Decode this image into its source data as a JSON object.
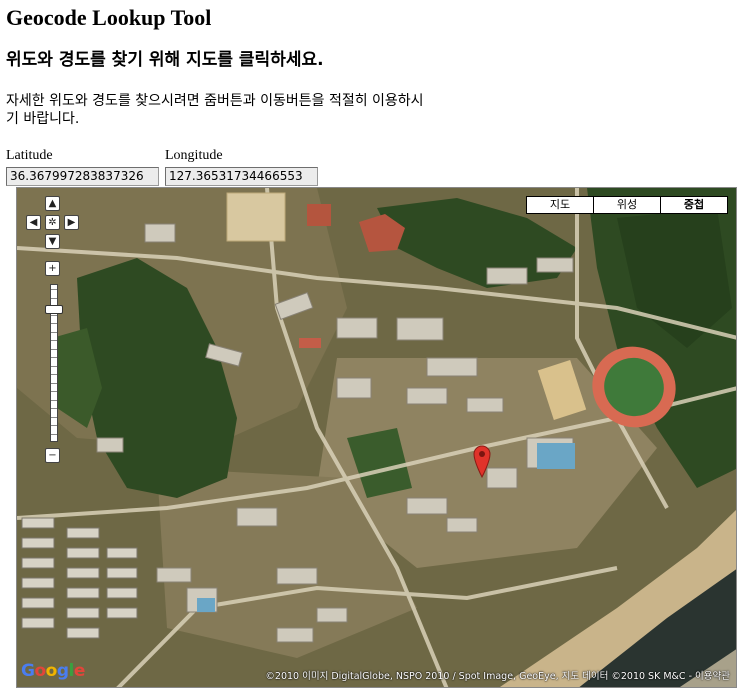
{
  "page": {
    "title": "Geocode Lookup Tool",
    "subtitle": "위도와 경도를 찾기 위해 지도를 클릭하세요.",
    "description": "자세한 위도와 경도를 찾으시려면 줌버튼과 이동버튼을 적절히 이용하시기 바랍니다."
  },
  "fields": {
    "latitude_label": "Latitude",
    "latitude_value": "36.367997283837326",
    "longitude_label": "Longitude",
    "longitude_value": "127.36531734466553"
  },
  "map": {
    "types": [
      "지도",
      "위성",
      "중첩"
    ],
    "active_type": "중첩",
    "logo_letters": [
      "G",
      "o",
      "o",
      "g",
      "l",
      "e"
    ],
    "copyright": "©2010 이미지 DigitalGlobe, NSPO 2010 / Spot Image, GeoEye, 지도 데이터 ©2010 SK M&C - 이용약관",
    "nav_icons": {
      "up": "▲",
      "left": "◀",
      "center": "✲",
      "right": "▶",
      "down": "▼",
      "zoom_in": "+",
      "zoom_out": "−"
    },
    "zoom_level_fraction": 0.86,
    "colors": {
      "vegetation": "#2e4a22",
      "ground": "#8b7a55",
      "track": "#d86a52",
      "field": "#3f7a3a",
      "river": "#2a3430",
      "marker": "#e0332a"
    }
  }
}
